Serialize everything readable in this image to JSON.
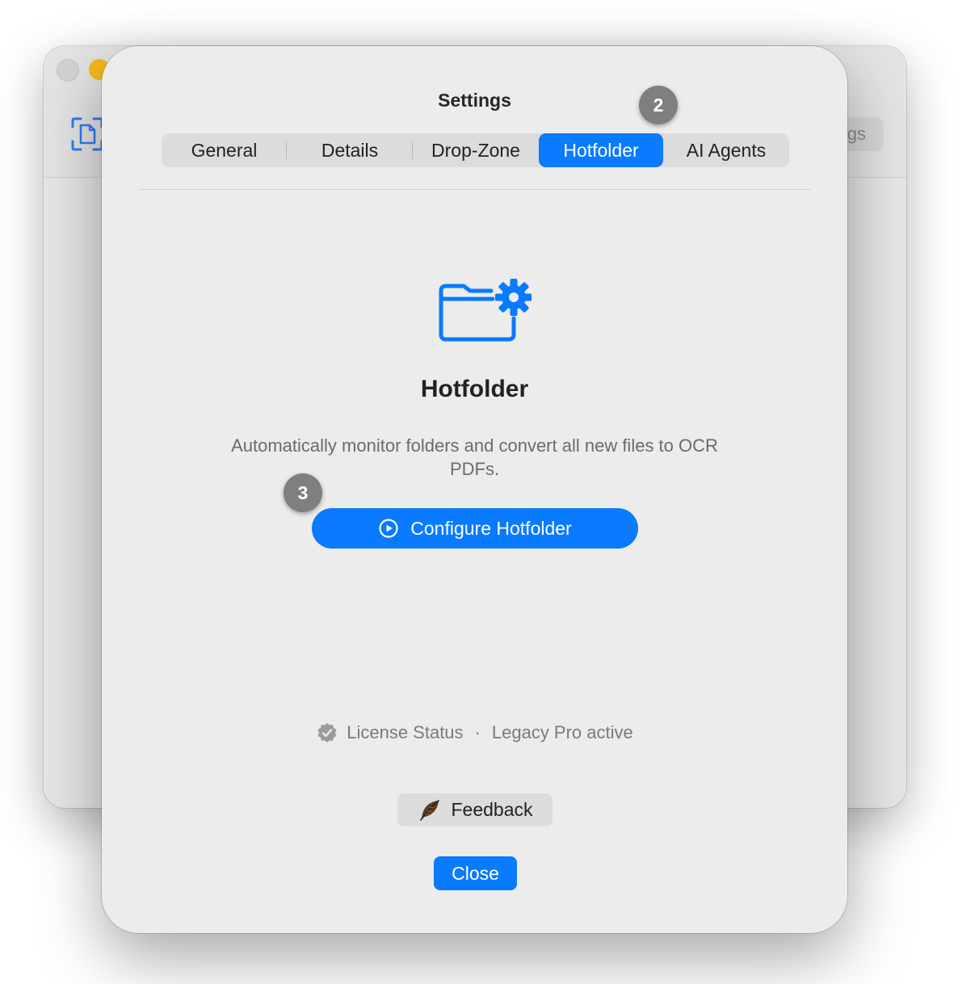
{
  "background_window": {
    "settings_button_label": "gs"
  },
  "dialog": {
    "title": "Settings",
    "tabs": [
      {
        "label": "General"
      },
      {
        "label": "Details"
      },
      {
        "label": "Drop-Zone"
      },
      {
        "label": "Hotfolder",
        "selected": true
      },
      {
        "label": "AI Agents"
      }
    ],
    "hero": {
      "icon": "folder-gear-icon",
      "title": "Hotfolder",
      "description": "Automatically monitor folders and convert all new files to OCR PDFs."
    },
    "configure_button": {
      "label": "Configure Hotfolder",
      "icon": "play-circle-icon"
    },
    "license": {
      "label": "License Status",
      "separator": "·",
      "value": "Legacy Pro active",
      "icon": "checkmark-seal-icon"
    },
    "feedback_button": {
      "label": "Feedback",
      "icon": "feather-icon"
    },
    "close_button": {
      "label": "Close"
    }
  },
  "step_badges": [
    {
      "number": "2"
    },
    {
      "number": "3"
    }
  ],
  "colors": {
    "accent": "#0a7aff",
    "badge": "#7f7f7f",
    "dialog_bg": "#ececec"
  }
}
